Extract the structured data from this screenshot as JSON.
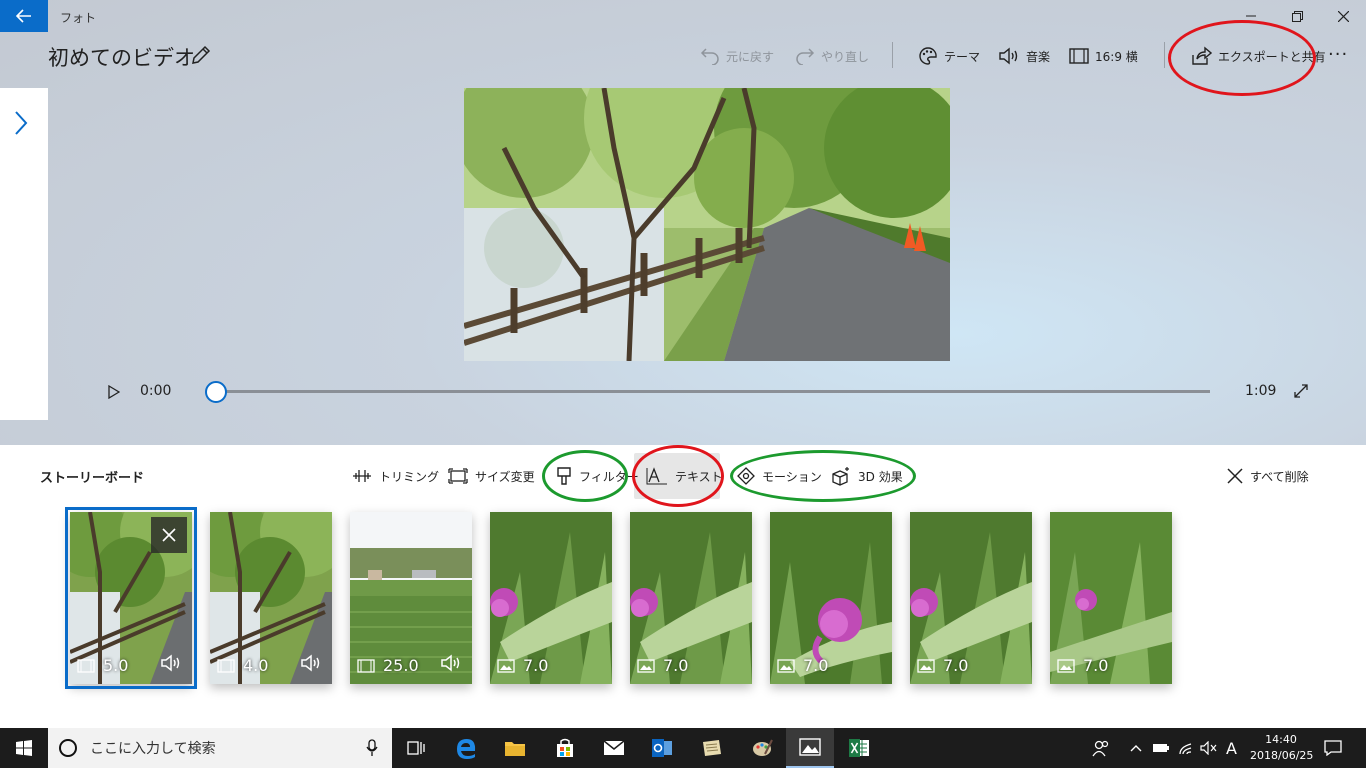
{
  "window": {
    "app_name": "フォト",
    "back_icon": "arrow-left-icon",
    "controls": [
      "minimize-icon",
      "restore-icon",
      "close-icon"
    ]
  },
  "header": {
    "project_title": "初めてのビデオ",
    "commands": {
      "undo": "元に戻す",
      "redo": "やり直し",
      "theme": "テーマ",
      "music": "音楽",
      "aspect": "16:9 横",
      "export": "エクスポートと共有",
      "more": "···"
    }
  },
  "player": {
    "current_time": "0:00",
    "duration": "1:09",
    "progress": 0
  },
  "storyboard": {
    "title": "ストーリーボード",
    "tools": {
      "trim": "トリミング",
      "resize": "サイズ変更",
      "filter": "フィルター",
      "text": "テキスト",
      "motion": "モーション",
      "effects3d": "3D 効果",
      "delete_all": "すべて削除"
    },
    "clips": [
      {
        "type": "video",
        "duration": "5.0",
        "audio": true,
        "selected": true,
        "scene": "forest-fence"
      },
      {
        "type": "video",
        "duration": "4.0",
        "audio": true,
        "selected": false,
        "scene": "forest-fence"
      },
      {
        "type": "video",
        "duration": "25.0",
        "audio": true,
        "selected": false,
        "scene": "field"
      },
      {
        "type": "photo",
        "duration": "7.0",
        "audio": false,
        "selected": false,
        "scene": "thistle-a"
      },
      {
        "type": "photo",
        "duration": "7.0",
        "audio": false,
        "selected": false,
        "scene": "thistle-a"
      },
      {
        "type": "photo",
        "duration": "7.0",
        "audio": false,
        "selected": false,
        "scene": "thistle-b"
      },
      {
        "type": "photo",
        "duration": "7.0",
        "audio": false,
        "selected": false,
        "scene": "thistle-a"
      },
      {
        "type": "photo",
        "duration": "7.0",
        "audio": false,
        "selected": false,
        "scene": "thistle-c"
      }
    ]
  },
  "taskbar": {
    "search_placeholder": "ここに入力して検索",
    "time": "14:40",
    "date": "2018/06/25",
    "ime": "A"
  },
  "colors": {
    "accent": "#0a6cc9",
    "annotation_red": "#e0151c",
    "annotation_green": "#1c9a2e"
  }
}
